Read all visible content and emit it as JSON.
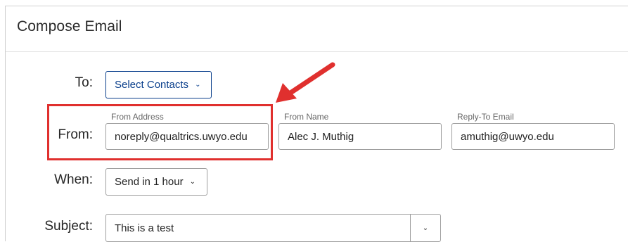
{
  "dialog": {
    "title": "Compose Email"
  },
  "to": {
    "label": "To:",
    "button_label": "Select Contacts"
  },
  "from": {
    "label": "From:",
    "address_caption": "From Address",
    "address_value": "noreply@qualtrics.uwyo.edu",
    "name_caption": "From Name",
    "name_value": "Alec J. Muthig",
    "reply_caption": "Reply-To Email",
    "reply_value": "amuthig@uwyo.edu"
  },
  "when": {
    "label": "When:",
    "selected": "Send in 1 hour"
  },
  "subject": {
    "label": "Subject:",
    "value": "This is a test"
  },
  "icons": {
    "chevron": "chevron-down-icon",
    "annotation_arrow": "arrow-icon"
  },
  "colors": {
    "accent_blue": "#0a3f8c",
    "annotation_red": "#e0302e"
  }
}
